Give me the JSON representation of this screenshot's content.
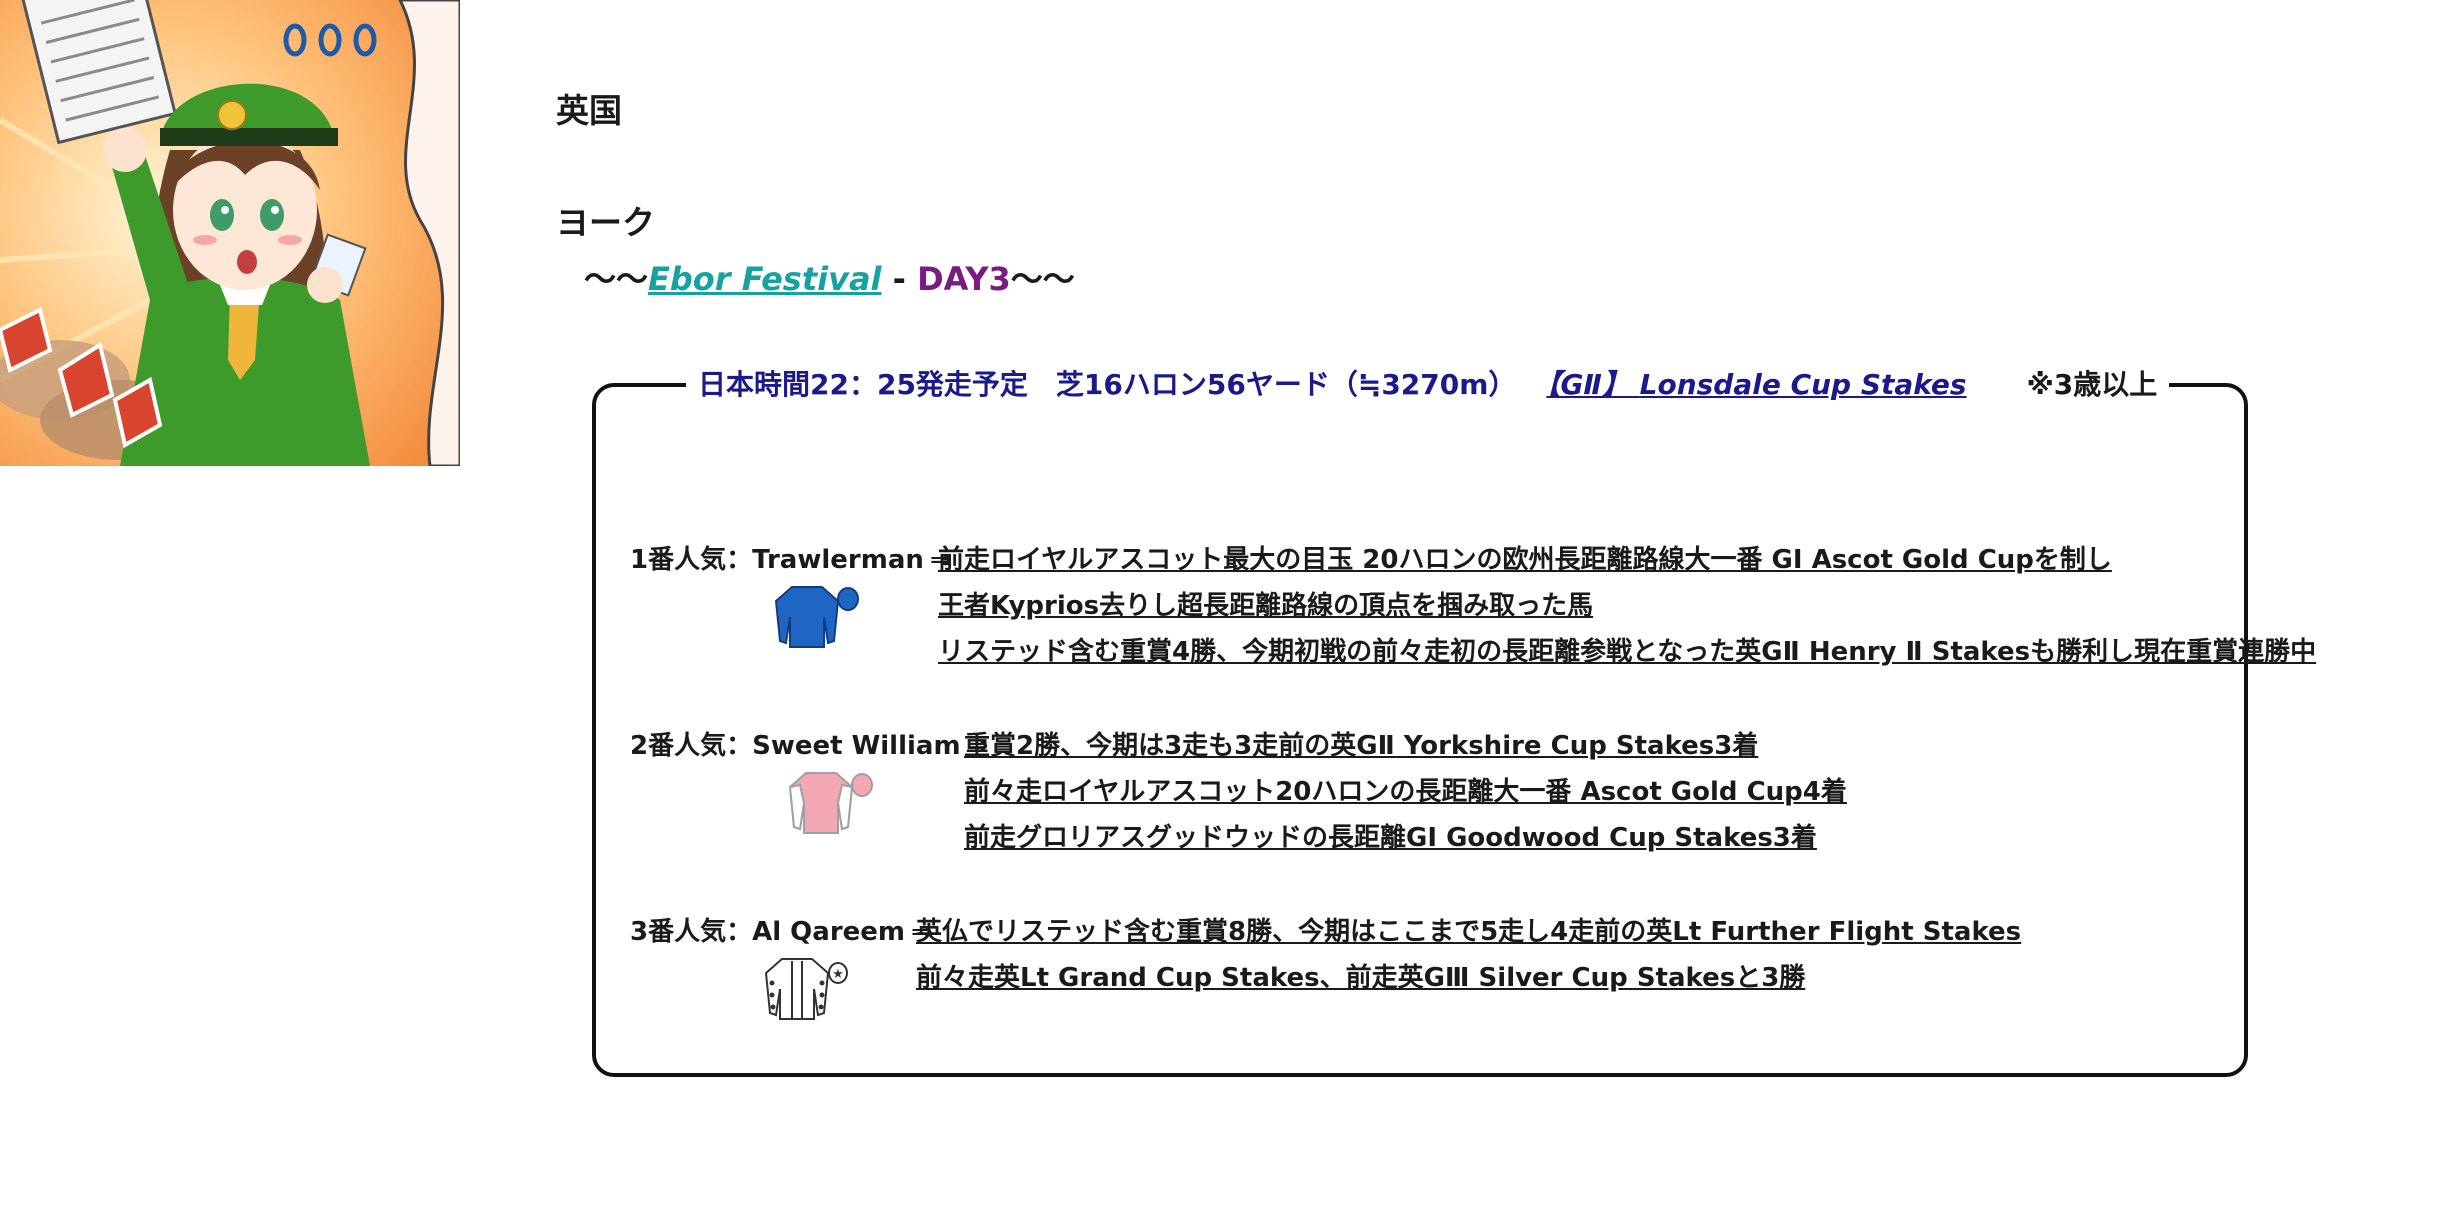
{
  "page": {
    "country": "英国",
    "venue": "ヨーク",
    "festival": {
      "prefix": "～～",
      "name": "Ebor Festival",
      "separator": " - ",
      "day": "DAY3",
      "suffix": "～～"
    }
  },
  "race": {
    "time_and_distance": "日本時間22：25発走予定　芝16ハロン56ヤード（≒3270m）",
    "grade": "【GⅡ】",
    "name": "Lonsdale Cup Stakes",
    "age_condition": "※3歳以上",
    "picks": [
      {
        "rank": "1番人気：",
        "horse": "Trawlerman",
        "arrow": "⇒",
        "notes": [
          "前走ロイヤルアスコット最大の目玉 20ハロンの欧州長距離路線大一番 GⅠ Ascot Gold Cupを制し",
          "王者Kyprios去りし超長距離路線の頂点を掴み取った馬",
          "リステッド含む重賞4勝、今期初戦の前々走初の長距離参戦となった英GⅡ Henry Ⅱ Stakesも勝利し現在重賞連勝中"
        ],
        "silks_color": "#1f66c4"
      },
      {
        "rank": "2番人気：",
        "horse": "Sweet William",
        "arrow": "⇒",
        "notes": [
          "重賞2勝、今期は3走も3走前の英GⅡ Yorkshire Cup Stakes3着",
          "前々走ロイヤルアスコット20ハロンの長距離大一番 Ascot Gold Cup4着",
          "前走グロリアスグッドウッドの長距離GⅠ Goodwood Cup Stakes3着"
        ],
        "silks_color": "#f2a7b2"
      },
      {
        "rank": "3番人気：",
        "horse": "Al Qareem",
        "arrow": "⇒",
        "notes": [
          "英仏でリステッド含む重賞8勝、今期はここまで5走し4走前の英Lt Further Flight Stakes",
          "前々走英Lt Grand Cup Stakes、前走英GⅢ Silver Cup Stakesと3勝"
        ],
        "silks_color": "#ffffff"
      }
    ]
  }
}
